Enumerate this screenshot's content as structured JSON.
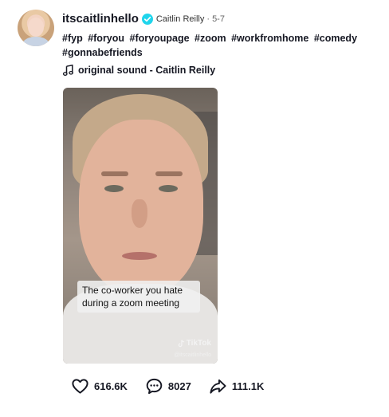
{
  "author": {
    "username": "itscaitlinhello",
    "nickname": "Caitlin Reilly",
    "separator": "·",
    "date": "5-7"
  },
  "caption": {
    "hashtags": [
      "#fyp",
      "#foryou",
      "#foryoupage",
      "#zoom",
      "#workfromhome",
      "#comedy",
      "#gonnabefriends"
    ]
  },
  "music": {
    "label": "original sound - Caitlin Reilly"
  },
  "video": {
    "overlay_text": "The co-worker you hate during a zoom meeting",
    "watermark": "TikTok",
    "watermark_handle": "@itscaitlinhello"
  },
  "actions": {
    "likes": "616.6K",
    "comments": "8027",
    "shares": "111.1K"
  },
  "icons": {
    "verified": "verified-badge-icon",
    "music": "music-note-icon",
    "like": "heart-icon",
    "comment": "comment-icon",
    "share": "share-arrow-icon"
  },
  "colors": {
    "verified": "#20d5ec",
    "text": "#161823"
  }
}
